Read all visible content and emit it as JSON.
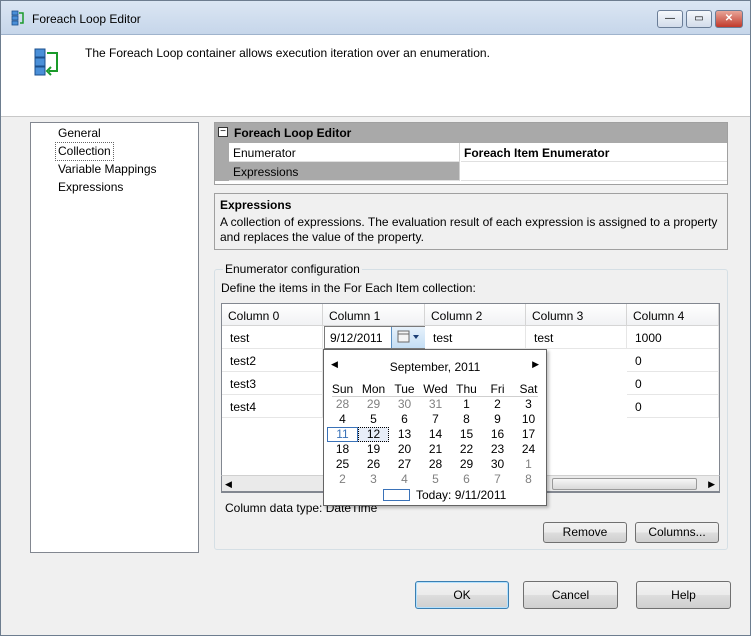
{
  "window": {
    "title": "Foreach Loop Editor",
    "description": "The Foreach Loop container allows execution iteration over an enumeration."
  },
  "nav": {
    "items": [
      {
        "label": "General"
      },
      {
        "label": "Collection",
        "selected": true
      },
      {
        "label": "Variable Mappings"
      },
      {
        "label": "Expressions"
      }
    ]
  },
  "property_grid": {
    "category": "Foreach Loop Editor",
    "rows": [
      {
        "name": "Enumerator",
        "value": "Foreach Item Enumerator"
      },
      {
        "name": "Expressions",
        "value": "",
        "selected": true
      }
    ]
  },
  "description_panel": {
    "title": "Expressions",
    "body": "A collection of expressions. The evaluation result of each expression is assigned to a property and replaces the value of the property."
  },
  "enumerator_config": {
    "group_title": "Enumerator configuration",
    "instruction": "Define the items in the For Each Item collection:",
    "columns": [
      "Column 0",
      "Column 1",
      "Column 2",
      "Column 3",
      "Column 4"
    ],
    "rows": [
      [
        "test",
        "9/12/2011",
        "test",
        "test",
        "1000"
      ],
      [
        "test2",
        "",
        "",
        "",
        "0"
      ],
      [
        "test3",
        "",
        "",
        "",
        "0"
      ],
      [
        "test4",
        "",
        "",
        "",
        "0"
      ]
    ],
    "data_type_label": "Column data type: DateTime",
    "remove_label": "Remove",
    "columns_label": "Columns..."
  },
  "calendar": {
    "month_label": "September, 2011",
    "days_of_week": [
      "Sun",
      "Mon",
      "Tue",
      "Wed",
      "Thu",
      "Fri",
      "Sat"
    ],
    "weeks": [
      [
        {
          "d": "28",
          "o": true
        },
        {
          "d": "29",
          "o": true
        },
        {
          "d": "30",
          "o": true
        },
        {
          "d": "31",
          "o": true
        },
        {
          "d": "1"
        },
        {
          "d": "2"
        },
        {
          "d": "3"
        }
      ],
      [
        {
          "d": "4"
        },
        {
          "d": "5"
        },
        {
          "d": "6"
        },
        {
          "d": "7"
        },
        {
          "d": "8"
        },
        {
          "d": "9"
        },
        {
          "d": "10"
        }
      ],
      [
        {
          "d": "11",
          "today": true
        },
        {
          "d": "12",
          "sel": true
        },
        {
          "d": "13"
        },
        {
          "d": "14"
        },
        {
          "d": "15"
        },
        {
          "d": "16"
        },
        {
          "d": "17"
        }
      ],
      [
        {
          "d": "18"
        },
        {
          "d": "19"
        },
        {
          "d": "20"
        },
        {
          "d": "21"
        },
        {
          "d": "22"
        },
        {
          "d": "23"
        },
        {
          "d": "24"
        }
      ],
      [
        {
          "d": "25"
        },
        {
          "d": "26"
        },
        {
          "d": "27"
        },
        {
          "d": "28"
        },
        {
          "d": "29"
        },
        {
          "d": "30"
        },
        {
          "d": "1",
          "o": true
        }
      ],
      [
        {
          "d": "2",
          "o": true
        },
        {
          "d": "3",
          "o": true
        },
        {
          "d": "4",
          "o": true
        },
        {
          "d": "5",
          "o": true
        },
        {
          "d": "6",
          "o": true
        },
        {
          "d": "7",
          "o": true
        },
        {
          "d": "8",
          "o": true
        }
      ]
    ],
    "today_label": "Today: 9/11/2011"
  },
  "footer": {
    "ok_label": "OK",
    "cancel_label": "Cancel",
    "help_label": "Help"
  }
}
